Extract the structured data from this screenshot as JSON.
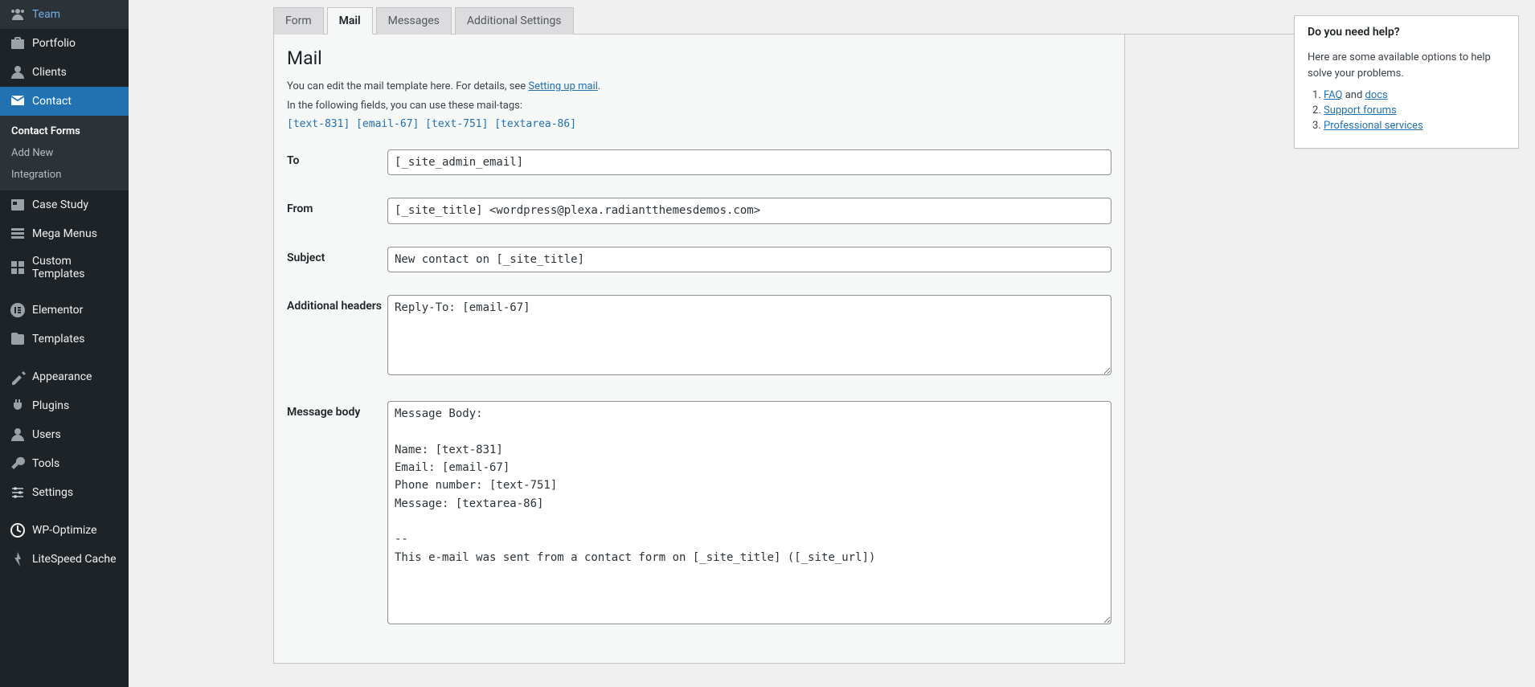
{
  "sidebar": {
    "items": [
      {
        "label": "Team",
        "icon": "team"
      },
      {
        "label": "Portfolio",
        "icon": "portfolio"
      },
      {
        "label": "Clients",
        "icon": "clients"
      },
      {
        "label": "Contact",
        "icon": "contact",
        "active": true
      },
      {
        "label": "Case Study",
        "icon": "casestudy"
      },
      {
        "label": "Mega Menus",
        "icon": "megamenus"
      },
      {
        "label": "Custom Templates",
        "icon": "customtemplates"
      },
      {
        "label": "Elementor",
        "icon": "elementor"
      },
      {
        "label": "Templates",
        "icon": "templates"
      },
      {
        "label": "Appearance",
        "icon": "appearance"
      },
      {
        "label": "Plugins",
        "icon": "plugins"
      },
      {
        "label": "Users",
        "icon": "users"
      },
      {
        "label": "Tools",
        "icon": "tools"
      },
      {
        "label": "Settings",
        "icon": "settings"
      },
      {
        "label": "WP-Optimize",
        "icon": "wpoptimize"
      },
      {
        "label": "LiteSpeed Cache",
        "icon": "litespeed"
      }
    ],
    "submenu": [
      {
        "label": "Contact Forms",
        "current": true
      },
      {
        "label": "Add New"
      },
      {
        "label": "Integration"
      }
    ]
  },
  "tabs": [
    {
      "label": "Form"
    },
    {
      "label": "Mail",
      "active": true
    },
    {
      "label": "Messages"
    },
    {
      "label": "Additional Settings"
    }
  ],
  "mail_panel": {
    "heading": "Mail",
    "intro_line1_a": "You can edit the mail template here. For details, see ",
    "intro_link": "Setting up mail",
    "intro_line1_b": ".",
    "intro_line2": "In the following fields, you can use these mail-tags:",
    "mail_tags": "[text-831] [email-67] [text-751] [textarea-86]",
    "fields": {
      "to": {
        "label": "To",
        "value": "[_site_admin_email]"
      },
      "from": {
        "label": "From",
        "value": "[_site_title] <wordpress@plexa.radiantthemesdemos.com>"
      },
      "subject": {
        "label": "Subject",
        "value": "New contact on [_site_title]"
      },
      "additional_headers": {
        "label": "Additional headers",
        "value": "Reply-To: [email-67]"
      },
      "message_body": {
        "label": "Message body",
        "value": "Message Body:\n\nName: [text-831]\nEmail: [email-67]\nPhone number: [text-751]\nMessage: [textarea-86]\n\n--\nThis e-mail was sent from a contact form on [_site_title] ([_site_url])"
      }
    }
  },
  "help": {
    "heading": "Do you need help?",
    "intro": "Here are some available options to help solve your problems.",
    "links": {
      "faq": "FAQ",
      "and": " and ",
      "docs": "docs",
      "forums": "Support forums",
      "pro": "Professional services"
    }
  }
}
